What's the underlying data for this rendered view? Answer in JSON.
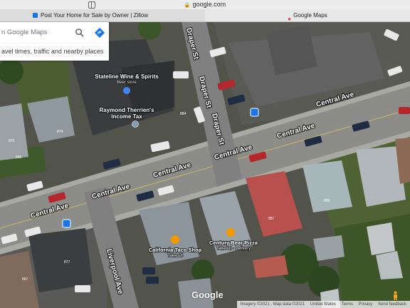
{
  "browser": {
    "url": "google.com",
    "tabs": [
      {
        "title": "Post Your Home for Sale by Owner | Zillow"
      },
      {
        "title": "Google Maps"
      }
    ]
  },
  "search": {
    "placeholder": "n Google Maps",
    "info_text": "avel times, traffic and nearby places"
  },
  "streets": {
    "central_ave": "Central Ave",
    "draper_st": "Draper St",
    "liverpool_ave": "Liverpool Ave"
  },
  "places": [
    {
      "name": "Stateline Wine & Spirits",
      "category": "Beer store",
      "icon": "shopping-bag-icon",
      "color": "#4285f4"
    },
    {
      "name": "Raymond Therrien's",
      "category": "Income Tax",
      "icon": "place-pin-icon",
      "color": "#7e9bb7"
    },
    {
      "name": "California Taco Shop",
      "category": "Takeout",
      "icon": "restaurant-icon",
      "color": "#f29900"
    },
    {
      "name": "Century Bear Pizza",
      "category": "Takeout · Delivery",
      "icon": "restaurant-icon",
      "color": "#f29900"
    }
  ],
  "building_numbers": [
    "884",
    "874",
    "870",
    "866",
    "889",
    "887",
    "877",
    "867"
  ],
  "logo": "Google",
  "footer": {
    "data": "Map data ©2021",
    "imagery": "Imagery ©2021 , Map data ©2021",
    "country": "United States",
    "terms": "Terms",
    "privacy": "Privacy",
    "feedback": "Send feedback"
  }
}
